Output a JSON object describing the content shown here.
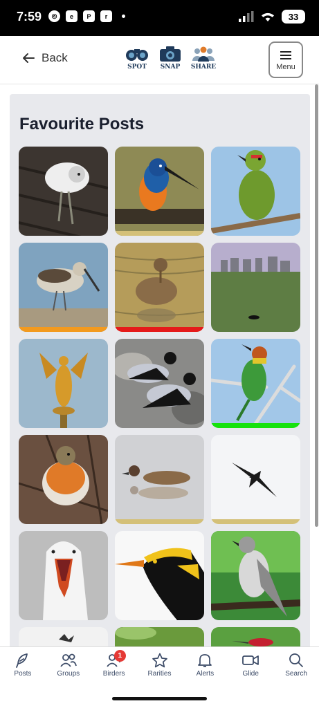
{
  "status": {
    "time": "7:59",
    "battery": "33"
  },
  "header": {
    "back_label": "Back",
    "logos": [
      "SPOT",
      "SNAP",
      "SHARE"
    ],
    "menu_label": "Menu"
  },
  "page": {
    "title": "Favourite Posts"
  },
  "posts": [
    {
      "subject": "white bird on wooden deck",
      "strip_color": null
    },
    {
      "subject": "kingfisher on branch",
      "strip_color": "#d4c078"
    },
    {
      "subject": "green barbet on branch",
      "strip_color": null
    },
    {
      "subject": "sandpiper in water",
      "strip_color": "#f39a1e"
    },
    {
      "subject": "brown wader in pond",
      "strip_color": "#e51a1a"
    },
    {
      "subject": "stone circle landscape",
      "strip_color": null
    },
    {
      "subject": "golden winged statue",
      "strip_color": null
    },
    {
      "subject": "hooded crows on rocks",
      "strip_color": null
    },
    {
      "subject": "bee-eater on branch",
      "strip_color": "#16e20d"
    },
    {
      "subject": "robin on twig",
      "strip_color": null
    },
    {
      "subject": "duck on water",
      "strip_color": "#d4c078"
    },
    {
      "subject": "frigatebird in flight",
      "strip_color": "#d4c078"
    },
    {
      "subject": "gull head close-up",
      "strip_color": null
    },
    {
      "subject": "yellow crested black bird",
      "strip_color": null
    },
    {
      "subject": "grey flycatcher on branch",
      "strip_color": null
    },
    {
      "subject": "partial image",
      "strip_color": null
    },
    {
      "subject": "partial image",
      "strip_color": null
    },
    {
      "subject": "partial image",
      "strip_color": null
    }
  ],
  "nav": [
    {
      "label": "Posts",
      "icon": "feather-icon"
    },
    {
      "label": "Groups",
      "icon": "group-icon"
    },
    {
      "label": "Birders",
      "icon": "add-person-icon",
      "badge": "1"
    },
    {
      "label": "Rarities",
      "icon": "star-icon"
    },
    {
      "label": "Alerts",
      "icon": "bell-icon"
    },
    {
      "label": "Glide",
      "icon": "video-icon"
    },
    {
      "label": "Search",
      "icon": "search-icon"
    }
  ]
}
